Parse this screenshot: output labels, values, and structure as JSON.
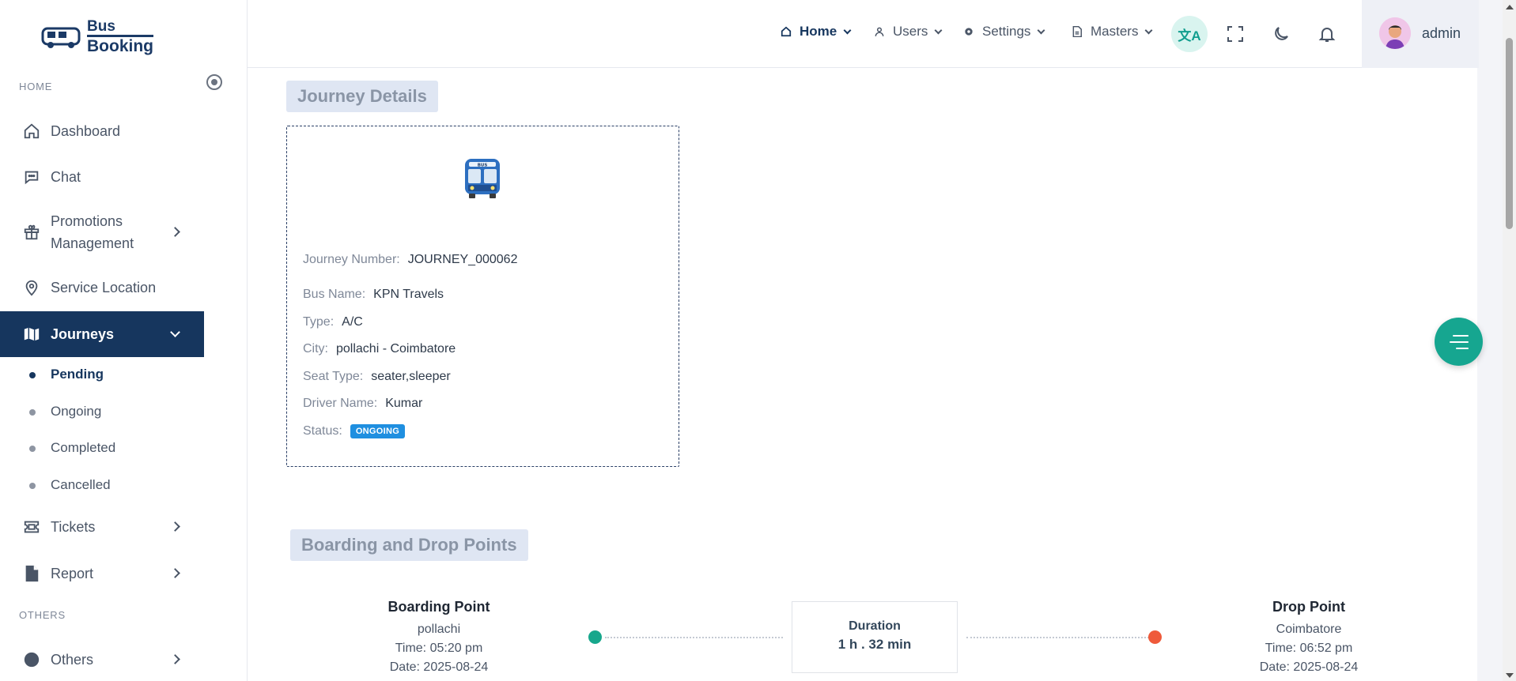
{
  "brand": {
    "line1": "Bus",
    "line2": "Booking"
  },
  "sidebar": {
    "home_section": "HOME",
    "others_section": "OTHERS",
    "items": {
      "dashboard": "Dashboard",
      "chat": "Chat",
      "promotions_line1": "Promotions",
      "promotions_line2": "Management",
      "service_location": "Service Location",
      "journeys": "Journeys",
      "tickets": "Tickets",
      "report": "Report",
      "others": "Others"
    },
    "journeys_sub": [
      "Pending",
      "Ongoing",
      "Completed",
      "Cancelled"
    ]
  },
  "header": {
    "menu": {
      "home": "Home",
      "users": "Users",
      "settings": "Settings",
      "masters": "Masters"
    },
    "translate_icon_text": "文A",
    "user_name": "admin"
  },
  "journey_details": {
    "title": "Journey Details",
    "journey_number_label": "Journey Number:",
    "journey_number": "JOURNEY_000062",
    "bus_name_label": "Bus Name:",
    "bus_name": "KPN Travels",
    "type_label": "Type:",
    "type": "A/C",
    "city_label": "City:",
    "city": "pollachi - Coimbatore",
    "seat_type_label": "Seat Type:",
    "seat_type": "seater,sleeper",
    "driver_label": "Driver Name:",
    "driver": "Kumar",
    "status_label": "Status:",
    "status": "ONGOING",
    "bus_sign": "BUS"
  },
  "points": {
    "title": "Boarding and Drop Points",
    "boarding": {
      "heading": "Boarding Point",
      "place": "pollachi",
      "time": "Time: 05:20 pm",
      "date": "Date: 2025-08-24"
    },
    "drop": {
      "heading": "Drop Point",
      "place": "Coimbatore",
      "time": "Time: 06:52 pm",
      "date": "Date: 2025-08-24"
    },
    "duration_label": "Duration",
    "duration_value": "1 h . 32 min"
  },
  "colors": {
    "primary": "#16365e",
    "accent": "#16a690",
    "status_badge": "#1f8fe0",
    "boarding_dot": "#17a78c",
    "drop_dot": "#ef5a3a"
  }
}
